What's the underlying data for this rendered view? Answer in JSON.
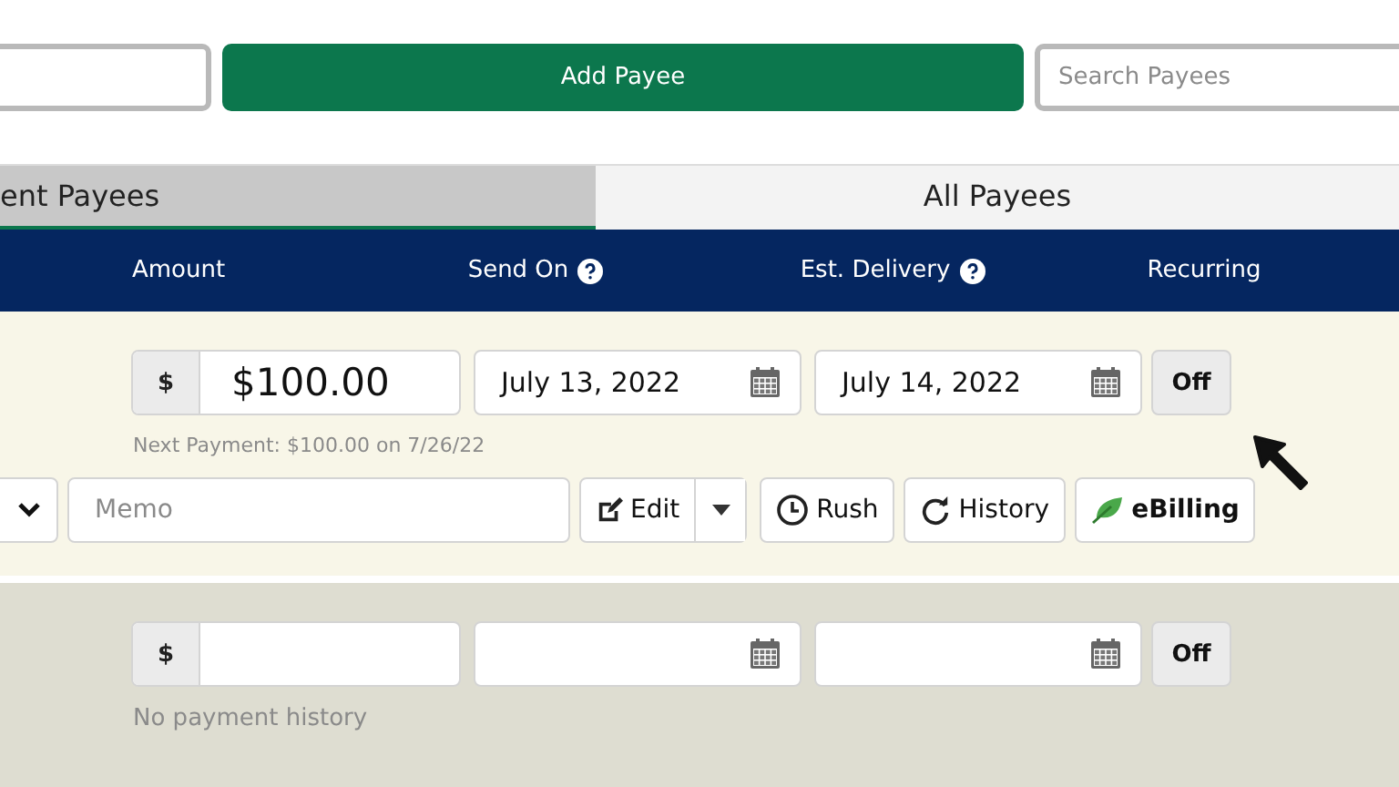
{
  "top_bar": {
    "add_button": "Add Payee",
    "search": {
      "placeholder": "Search Payees"
    }
  },
  "tabs": [
    {
      "label": "ent Payees",
      "selected": true
    },
    {
      "label": "All Payees",
      "selected": false
    }
  ],
  "columns": [
    {
      "label": "Amount",
      "help": false
    },
    {
      "label": "Send On",
      "help": true
    },
    {
      "label": "Est. Delivery",
      "help": true
    },
    {
      "label": "Recurring",
      "help": false
    }
  ],
  "payments": [
    {
      "highlighted": false,
      "currency": "$",
      "amount": "$100.00",
      "send_on": "July 13, 2022",
      "delivery": "July 14, 2022",
      "recurring": "Off",
      "note": "Next Payment: $100.00 on 7/26/22",
      "memo": {
        "placeholder": "Memo"
      },
      "actions": [
        {
          "kind": "edit",
          "label": "Edit"
        },
        {
          "kind": "rush",
          "label": "Rush"
        },
        {
          "kind": "history",
          "label": "History"
        },
        {
          "kind": "ebilling",
          "label": "eBilling"
        }
      ]
    },
    {
      "highlighted": true,
      "currency": "$",
      "recurring": "Off",
      "note": "No payment history"
    }
  ]
}
